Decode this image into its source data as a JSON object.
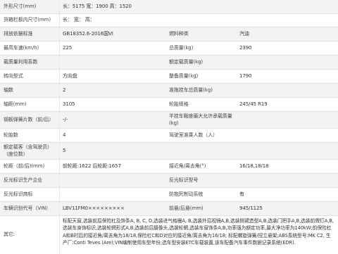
{
  "rows": [
    {
      "label": "外形尺寸(mm)",
      "value": "长：5175 宽：1900 高：1520"
    },
    {
      "label": "货箱栏板内尺寸(mm)",
      "value": "长： 宽： 高："
    },
    {
      "label": "排放依据标准",
      "value": "GB18352.6-2016国VI",
      "label2": "燃料种类",
      "value2": "汽油"
    },
    {
      "label": "最高车速(km/h)",
      "value": "225",
      "label2": "总质量(kg)",
      "value2": "2390"
    },
    {
      "label": "载质量利用系数",
      "value": "",
      "label2": "额定载质量(kg)",
      "value2": ""
    },
    {
      "label": "转向型式",
      "value": "方向盘",
      "label2": "整备质量(kg)",
      "value2": "1790"
    },
    {
      "label": "轴数",
      "value": "2",
      "label2": "准拖挂车总质量(kg)",
      "value2": ""
    },
    {
      "label": "轴距(mm)",
      "value": "3105",
      "label2": "轮胎规格",
      "value2": "245/45 R19"
    },
    {
      "label": "钢板弹簧片数（前/后）",
      "value": "-/-",
      "label2": "半挂车鞍座最大允许承载质量(kg)",
      "value2": ""
    },
    {
      "label": "轮胎数",
      "value": "4",
      "label2": "驾驶室准乘人数（人）",
      "value2": ""
    },
    {
      "label": "额定载客（含驾驶员）（座位数）",
      "value": "5"
    },
    {
      "label": "轮距（前/后)(mm)",
      "value": "前轮距:1622 后轮距:1657",
      "label2": "接近角/离去角(°)",
      "value2": "16/18,18/18"
    },
    {
      "label": "反光标识生产企业",
      "value": "",
      "label2": "反光标识型号",
      "value2": ""
    },
    {
      "label": "反光标识商标",
      "value": "",
      "label2": "防抱死制动系统",
      "value2": "有"
    },
    {
      "label": "车辆识别代号（VIN）",
      "value": "LBV11FM0×××××××××",
      "label2": "前悬/后悬(mm)",
      "value2": "945/1125"
    },
    {
      "label": "其它:",
      "value": "标配天窗,选装前后保险杠及饰条A, B, C, D,选装进气格栅A, B,选装外后视镜A,B,选装侧裙造型A,B,选装门把手A,B,选装前牌灯A,B,选装车身饰标识,选装轮辋形式A,B,选装前后摄像头,选装轮辋,选装车窗饰条A,B,功率强为额定功率,最大净功率为140kW;前保险杠A和B时后的接近角/离去角为18/18,保险杠C和D对应的接近角/离去角为16/18; 标配螺旋弹簧/扭立悬架;ABS系统型号:MK C2, 生产厂:Conti Teves (Are);VIN编制使用车型年份;选车型安装ETC车载装置,该车配备汽车事件数据记录系统(EDR)."
    }
  ]
}
